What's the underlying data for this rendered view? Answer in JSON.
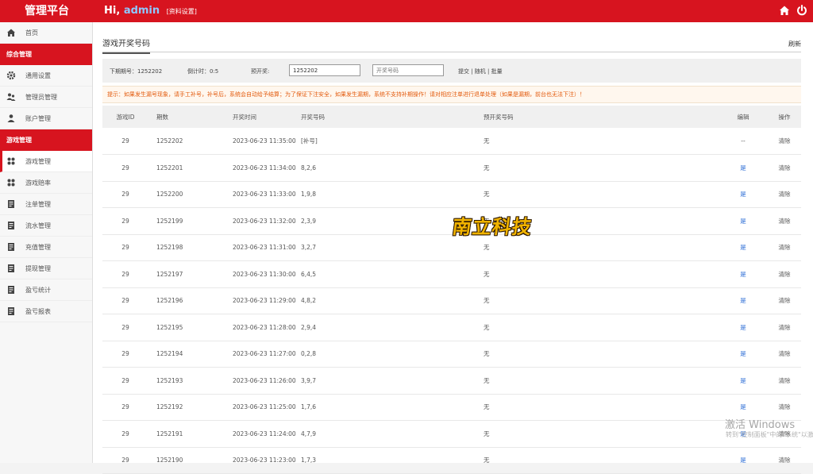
{
  "topbar": {
    "brand": "管理平台",
    "greeting": "Hi,",
    "username": "admin",
    "profile_link": "[资料设置]",
    "icons": [
      "home-icon",
      "power-icon"
    ]
  },
  "sidebar": {
    "home": "首页",
    "section1": "综合管理",
    "items1": [
      "通用设置",
      "管理员管理",
      "账户管理"
    ],
    "section2": "游戏管理",
    "items2": [
      "游戏管理",
      "游戏赔率",
      "注单管理",
      "流水管理",
      "充值管理",
      "提现管理",
      "盈亏统计",
      "盈亏报表"
    ]
  },
  "main": {
    "title": "游戏开奖号码",
    "refresh": "刷新",
    "next_issue": "下期期号：1252202",
    "countdown": "倒计时：0:5",
    "preset_label": "预开奖:",
    "preset_issue_value": "1252202",
    "preset_code_placeholder": "开奖号码",
    "actions": "提交 | 随机 | 批量",
    "tip": "提示：如果发生漏号现象，请手工补号，补号后，系统会自动给予结算；为了保证下注安全，如果发生漏期，系统不支持补期操作！请对相应注单进行退单处理（如果是漏期，前台也无法下注）！"
  },
  "table": {
    "headers": [
      "游戏ID",
      "期数",
      "开奖时间",
      "开奖号码",
      "预开奖号码",
      "编辑",
      "操作"
    ],
    "rows": [
      [
        "29",
        "1252202",
        "2023-06-23 11:35:00",
        "[补号]",
        "无",
        "--",
        "清除"
      ],
      [
        "29",
        "1252201",
        "2023-06-23 11:34:00",
        "8,2,6",
        "无",
        "是",
        "清除"
      ],
      [
        "29",
        "1252200",
        "2023-06-23 11:33:00",
        "1,9,8",
        "无",
        "是",
        "清除"
      ],
      [
        "29",
        "1252199",
        "2023-06-23 11:32:00",
        "2,3,9",
        "无",
        "是",
        "清除"
      ],
      [
        "29",
        "1252198",
        "2023-06-23 11:31:00",
        "3,2,7",
        "无",
        "是",
        "清除"
      ],
      [
        "29",
        "1252197",
        "2023-06-23 11:30:00",
        "6,4,5",
        "无",
        "是",
        "清除"
      ],
      [
        "29",
        "1252196",
        "2023-06-23 11:29:00",
        "4,8,2",
        "无",
        "是",
        "清除"
      ],
      [
        "29",
        "1252195",
        "2023-06-23 11:28:00",
        "2,9,4",
        "无",
        "是",
        "清除"
      ],
      [
        "29",
        "1252194",
        "2023-06-23 11:27:00",
        "0,2,8",
        "无",
        "是",
        "清除"
      ],
      [
        "29",
        "1252193",
        "2023-06-23 11:26:00",
        "3,9,7",
        "无",
        "是",
        "清除"
      ],
      [
        "29",
        "1252192",
        "2023-06-23 11:25:00",
        "1,7,6",
        "无",
        "是",
        "清除"
      ],
      [
        "29",
        "1252191",
        "2023-06-23 11:24:00",
        "4,7,9",
        "无",
        "是",
        "清除"
      ],
      [
        "29",
        "1252190",
        "2023-06-23 11:23:00",
        "1,7,3",
        "无",
        "是",
        "清除"
      ]
    ]
  },
  "overlays": {
    "logo_text": "南立科技",
    "windows_activation": "激活 Windows",
    "windows_activation_sub": "转到\"控制面板\"中的\"系统\"以激活 Windows"
  },
  "colors": {
    "brand_red": "#d7141f",
    "tip_orange": "#e35b0e",
    "link_blue": "#1e63d3"
  }
}
